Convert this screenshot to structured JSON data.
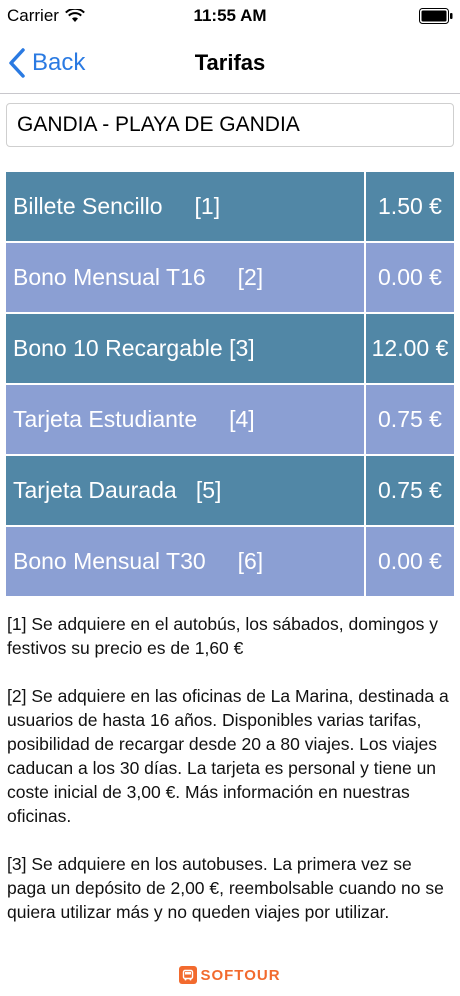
{
  "status_bar": {
    "carrier": "Carrier",
    "time": "11:55 AM"
  },
  "nav": {
    "back_label": "Back",
    "title": "Tarifas"
  },
  "route": {
    "value": "GANDIA - PLAYA DE GANDIA"
  },
  "fares": [
    {
      "name": "Billete Sencillo     [1]",
      "price": "1.50 €"
    },
    {
      "name": "Bono Mensual T16     [2]",
      "price": "0.00 €"
    },
    {
      "name": "Bono 10 Recargable [3]",
      "price": "12.00 €"
    },
    {
      "name": "Tarjeta Estudiante     [4]",
      "price": "0.75 €"
    },
    {
      "name": "Tarjeta Daurada   [5]",
      "price": "0.75 €"
    },
    {
      "name": "Bono Mensual T30     [6]",
      "price": "0.00 €"
    }
  ],
  "notes": [
    "[1] Se adquiere en el autobús, los sábados, domingos y festivos su precio es de 1,60 €",
    "[2] Se adquiere en las oficinas de La Marina, destinada a usuarios de hasta 16 años. Disponibles varias tarifas, posibilidad de recargar desde 20 a 80 viajes. Los viajes caducan a los 30 días. La tarjeta es personal y tiene un coste inicial de 3,00 €. Más información en nuestras oficinas.",
    "[3] Se adquiere en los autobuses. La primera vez se paga un depósito de 2,00 €, reembolsable cuando no se quiera utilizar más y no queden viajes por utilizar."
  ],
  "footer": {
    "logo_text": "SOFTOUR"
  },
  "colors": {
    "accent": "#2a7ae2",
    "row_dark": "#5187a6",
    "row_light": "#8b9fd3",
    "logo": "#f26a2e"
  }
}
